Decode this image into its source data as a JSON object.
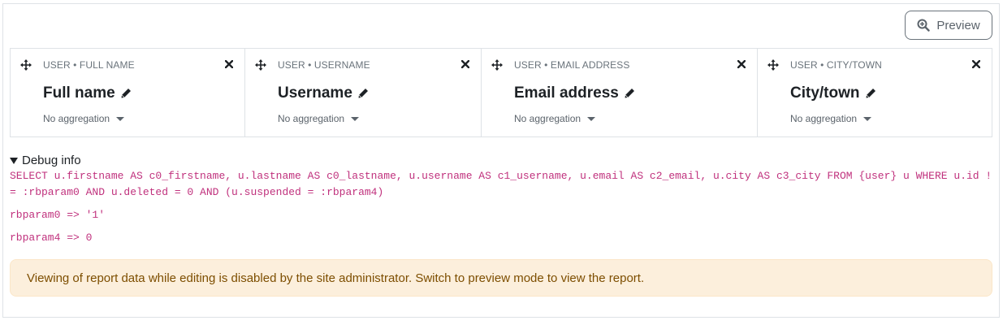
{
  "toolbar": {
    "preview_label": "Preview",
    "preview_icon": "magnifier-zoom-icon"
  },
  "columns": [
    {
      "source": "USER • FULL NAME",
      "title": "Full name",
      "aggregation": "No aggregation"
    },
    {
      "source": "USER • USERNAME",
      "title": "Username",
      "aggregation": "No aggregation"
    },
    {
      "source": "USER • EMAIL ADDRESS",
      "title": "Email address",
      "aggregation": "No aggregation"
    },
    {
      "source": "USER • CITY/TOWN",
      "title": "City/town",
      "aggregation": "No aggregation"
    }
  ],
  "debug": {
    "summary": "Debug info",
    "sql": "SELECT u.firstname AS c0_firstname, u.lastname AS c0_lastname, u.username AS c1_username, u.email AS c2_email, u.city AS c3_city FROM {user} u WHERE u.id != :rbparam0 AND u.deleted = 0 AND (u.suspended = :rbparam4)",
    "param0": "rbparam0 => '1'",
    "param4": "rbparam4 => 0"
  },
  "alert": {
    "message": "Viewing of report data while editing is disabled by the site administrator. Switch to preview mode to view the report."
  },
  "colors": {
    "code": "#c0317d",
    "alert_bg": "#fcefdc",
    "alert_text": "#7d4e00"
  }
}
